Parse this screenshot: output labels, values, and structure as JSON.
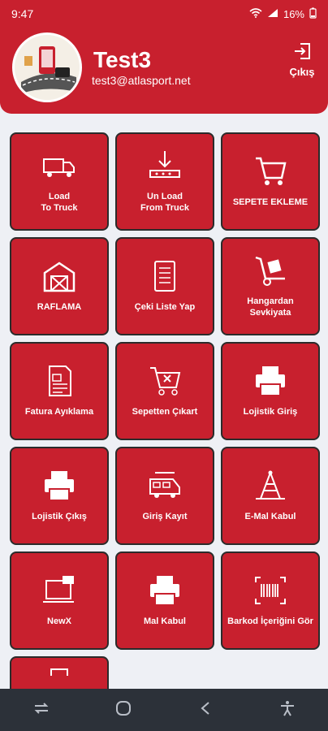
{
  "status": {
    "time": "9:47",
    "battery": "16%"
  },
  "user": {
    "name": "Test3",
    "email": "test3@atlasport.net"
  },
  "header": {
    "logout_label": "Çıkış"
  },
  "tiles": [
    {
      "label": "Load\nTo Truck",
      "icon": "truck-icon"
    },
    {
      "label": "Un Load\nFrom Truck",
      "icon": "unload-icon"
    },
    {
      "label": "SEPETE EKLEME",
      "icon": "cart-icon"
    },
    {
      "label": "RAFLAMA",
      "icon": "warehouse-icon"
    },
    {
      "label": "Çeki Liste Yap",
      "icon": "list-icon"
    },
    {
      "label": "Hangardan Sevkiyata",
      "icon": "handtruck-icon"
    },
    {
      "label": "Fatura Ayıklama",
      "icon": "invoice-icon"
    },
    {
      "label": "Sepetten Çıkart",
      "icon": "cart-remove-icon"
    },
    {
      "label": "Lojistik Giriş",
      "icon": "printer-icon"
    },
    {
      "label": "Lojistik Çıkış",
      "icon": "printer-icon"
    },
    {
      "label": "Giriş Kayıt",
      "icon": "van-icon"
    },
    {
      "label": "E-Mal Kabul",
      "icon": "tower-icon"
    },
    {
      "label": "NewX",
      "icon": "laptop-icon"
    },
    {
      "label": "Mal Kabul",
      "icon": "printer-icon"
    },
    {
      "label": "Barkod İçeriğini Gör",
      "icon": "barcode-icon"
    }
  ]
}
